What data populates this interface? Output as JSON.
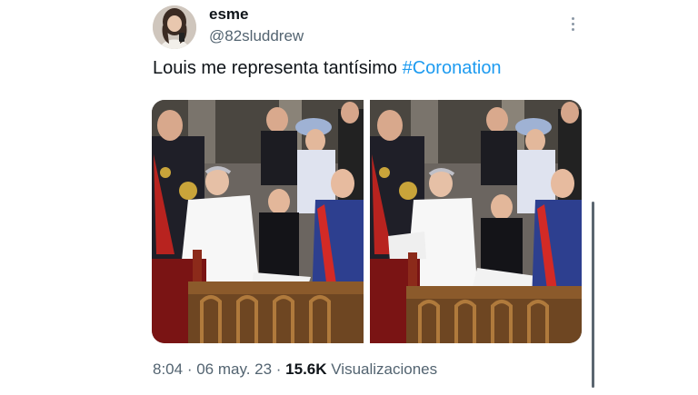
{
  "tweet": {
    "author": {
      "display_name": "esme",
      "handle": "@82sluddrew"
    },
    "text": {
      "before_hashtag": "Louis me representa tantísimo ",
      "hashtag": "#Coronation"
    },
    "media": {
      "photos": [
        {
          "subject": "coronation-ceremony-photo"
        },
        {
          "subject": "coronation-ceremony-photo"
        }
      ]
    },
    "meta": {
      "time": "8:04",
      "separator_1": " · ",
      "date": "06 may. 23",
      "separator_2": " · ",
      "views_count": "15.6K",
      "views_label": " Visualizaciones"
    }
  },
  "colors": {
    "hashtag": "#1d9bf0",
    "secondary_text": "#536471",
    "primary_text": "#0f1419"
  },
  "icons": {
    "more": "more-vertical-icon"
  }
}
